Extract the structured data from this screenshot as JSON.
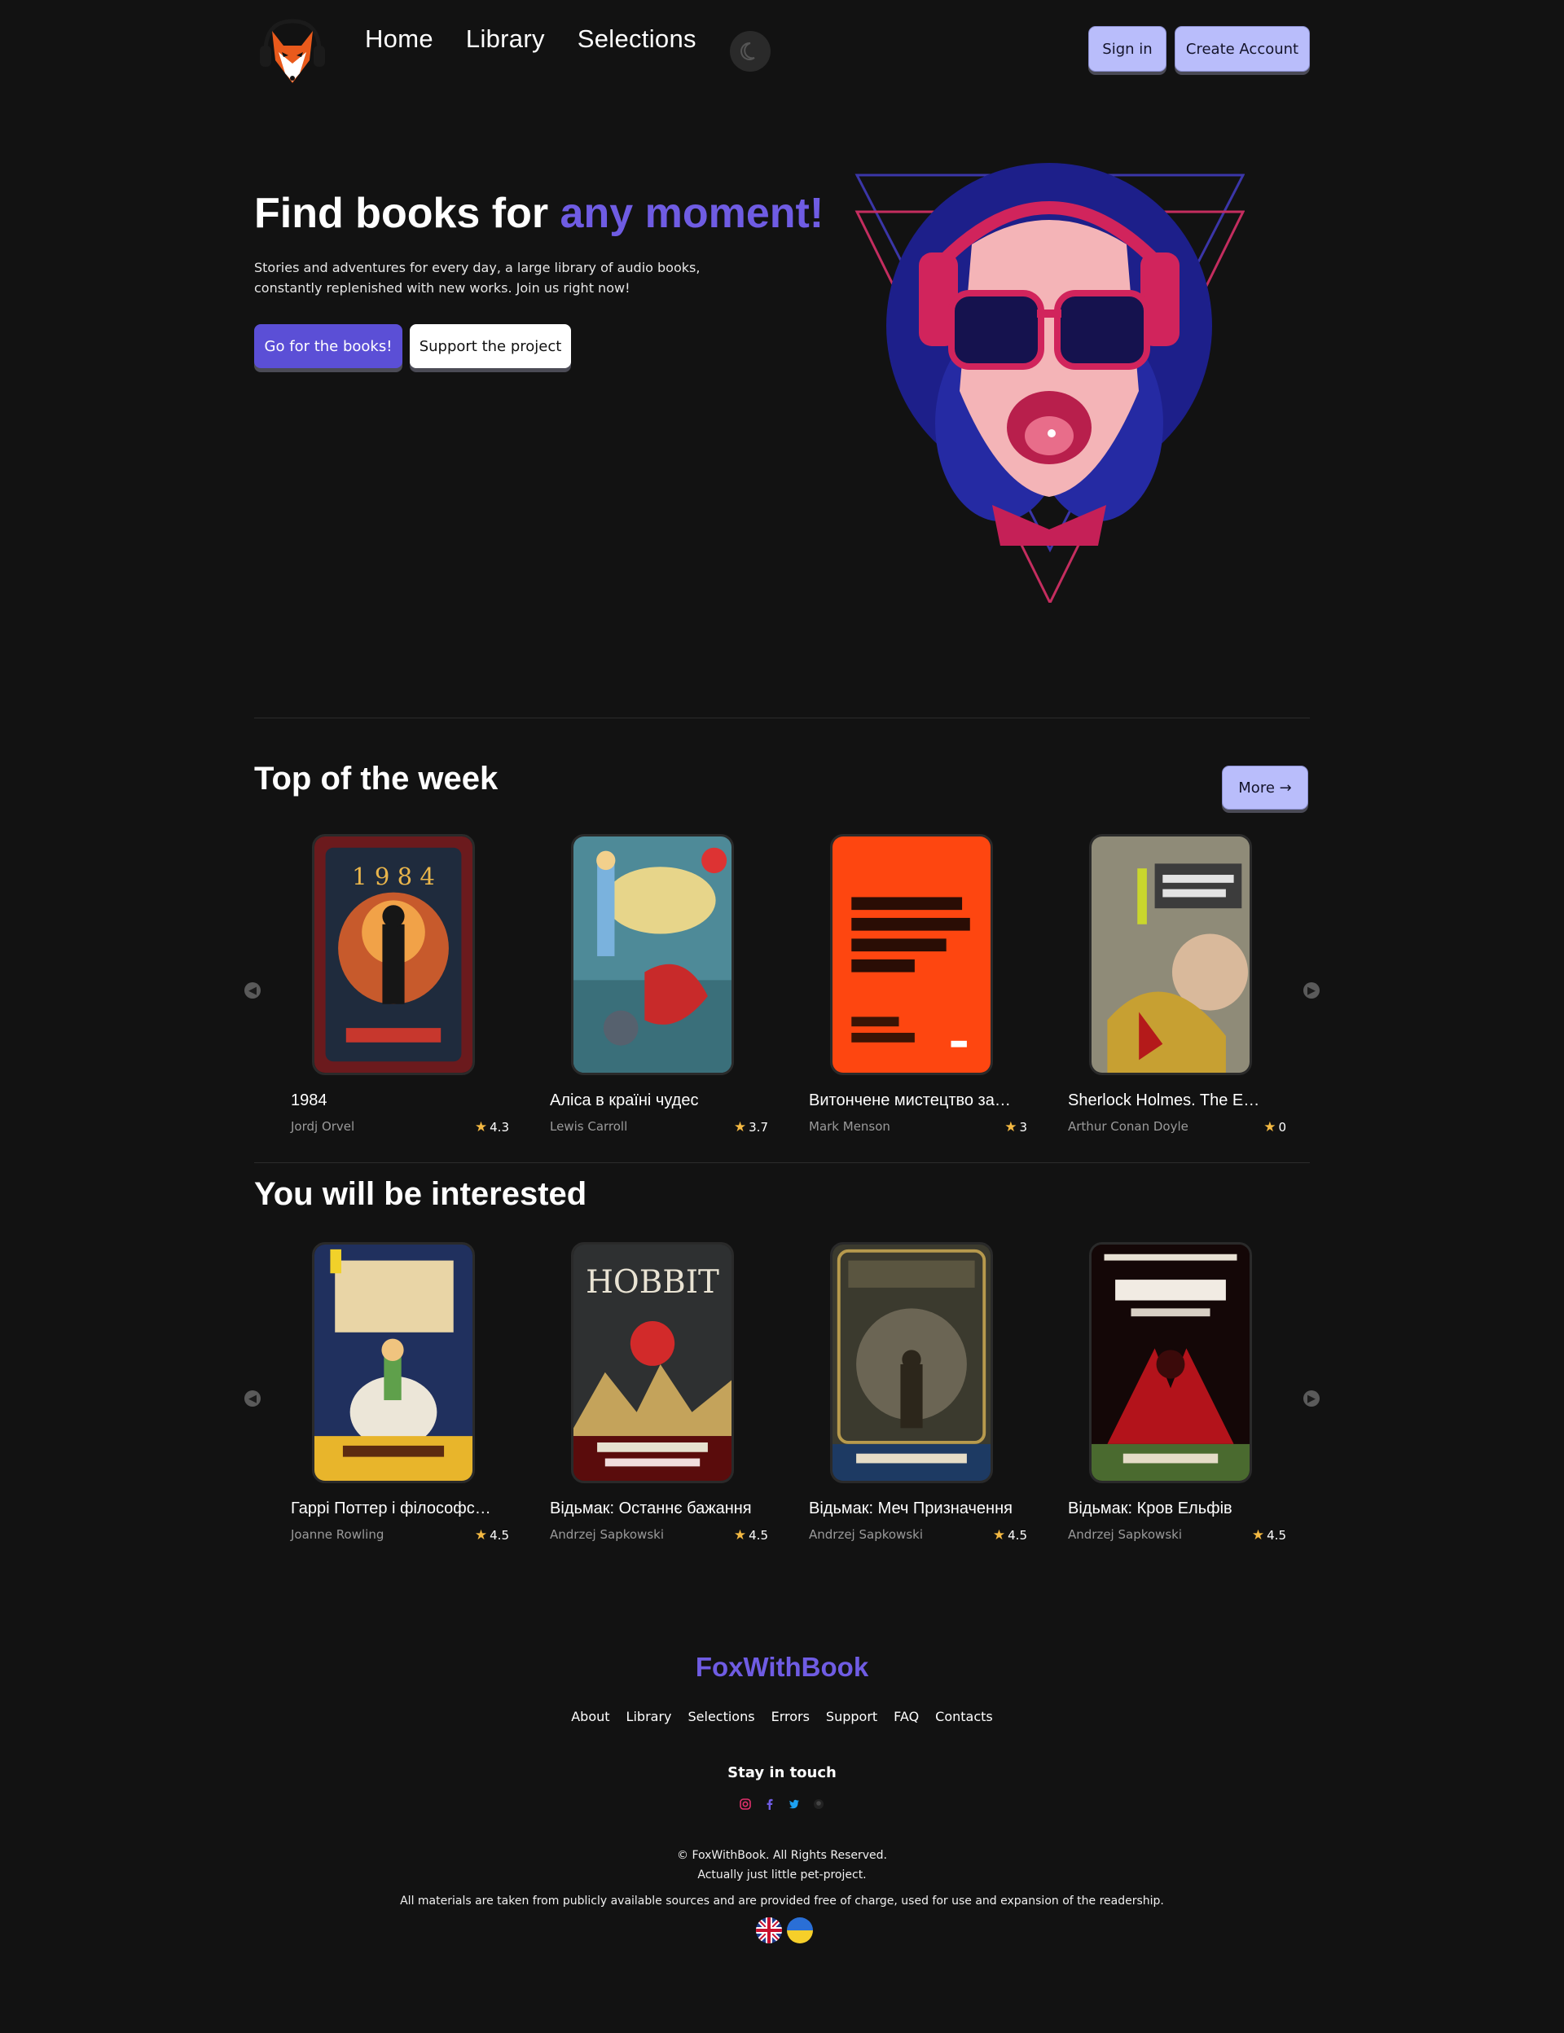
{
  "header": {
    "nav": [
      "Home",
      "Library",
      "Selections"
    ],
    "signin_label": "Sign in",
    "create_label": "Create Account"
  },
  "hero": {
    "title_main": "Find books for",
    "title_accent": "any moment!",
    "text": "Stories and adventures for every day, a large library of audio books, constantly replenished with new works. Join us right now!",
    "primary_btn": "Go for the books!",
    "secondary_btn": "Support the project"
  },
  "top_week": {
    "title": "Top of the week",
    "more_label": "More →",
    "books": [
      {
        "title": "1984",
        "author": "Jordj Orvel",
        "rating": "4.3"
      },
      {
        "title": "Аліса в країні чудес",
        "author": "Lewis Carroll",
        "rating": "3.7"
      },
      {
        "title": "Витончене мистецтво забивати на все",
        "author": "Mark Menson",
        "rating": "3"
      },
      {
        "title": "Sherlock Holmes. The Emerald Crown",
        "author": "Arthur Conan Doyle",
        "rating": "0"
      }
    ]
  },
  "interested": {
    "title": "You will be interested",
    "books": [
      {
        "title": "Гаррі Поттер і філософський камінь",
        "author": "Joanne Rowling",
        "rating": "4.5"
      },
      {
        "title": "Відьмак: Останнє бажання",
        "author": "Andrzej Sapkowski",
        "rating": "4.5"
      },
      {
        "title": "Відьмак: Меч Призначення",
        "author": "Andrzej Sapkowski",
        "rating": "4.5"
      },
      {
        "title": "Відьмак: Кров Ельфів",
        "author": "Andrzej Sapkowski",
        "rating": "4.5"
      }
    ]
  },
  "footer": {
    "brand": "FoxWithBook",
    "links": [
      "About",
      "Library",
      "Selections",
      "Errors",
      "Support",
      "FAQ",
      "Contacts"
    ],
    "stay": "Stay in touch",
    "social_icons": [
      "instagram-icon",
      "facebook-icon",
      "twitter-icon",
      "github-icon"
    ],
    "copyright": "© FoxWithBook. All Rights Reserved.",
    "pet": "Actually just little pet-project.",
    "disclaimer": "All materials are taken from publicly available sources and are provided free of charge, used for use and expansion of the readership."
  },
  "colors": {
    "accent": "#6f5ce3",
    "button_light": "#b9bdfb",
    "background": "#121212",
    "star": "#f4b942"
  }
}
